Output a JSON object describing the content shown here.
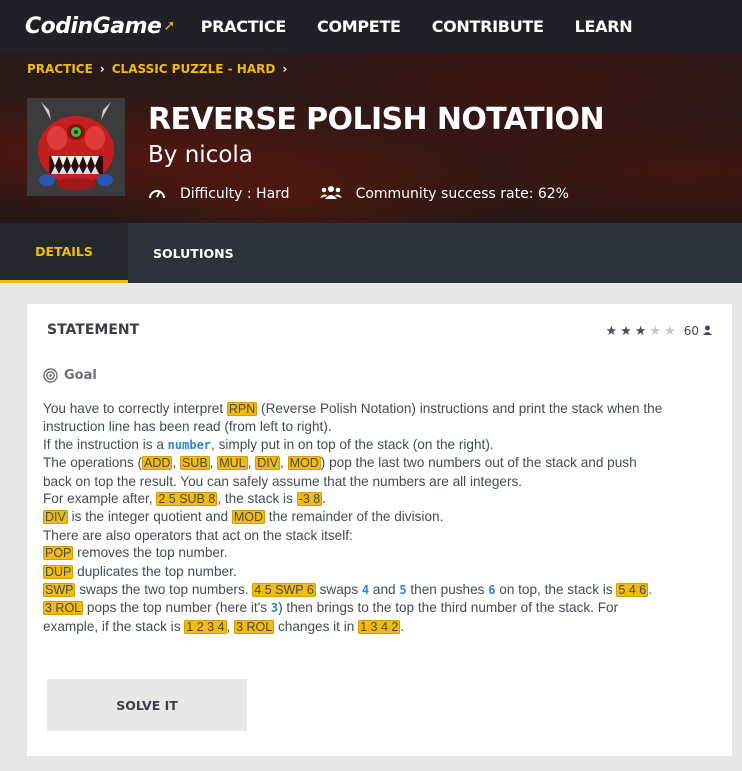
{
  "nav": {
    "logo": "CodinGame",
    "links": [
      "PRACTICE",
      "COMPETE",
      "CONTRIBUTE",
      "LEARN"
    ]
  },
  "breadcrumb": [
    "PRACTICE",
    "CLASSIC PUZZLE - HARD"
  ],
  "puzzle": {
    "title": "REVERSE POLISH NOTATION",
    "author": "By nicola",
    "difficulty": "Difficulty : Hard",
    "success_rate": "Community success rate: 62%"
  },
  "tabs": [
    "DETAILS",
    "SOLUTIONS"
  ],
  "statement": {
    "heading": "STATEMENT",
    "rating_stars": 3,
    "rating_max": 5,
    "rating_count": "60",
    "goal_label": "Goal",
    "lines": [
      [
        {
          "t": "You have to correctly interpret "
        },
        {
          "c": "RPN"
        },
        {
          "t": " (Reverse Polish Notation) instructions and print the stack when the"
        }
      ],
      [
        {
          "t": "instruction line has been read (from left to right)."
        }
      ],
      [
        {
          "t": "If the instruction is a "
        },
        {
          "v": "number"
        },
        {
          "t": ", simply put in on top of the stack (on the right)."
        }
      ],
      [
        {
          "t": "The operations ("
        },
        {
          "c": "ADD"
        },
        {
          "t": ", "
        },
        {
          "c": "SUB"
        },
        {
          "t": ", "
        },
        {
          "c": "MUL"
        },
        {
          "t": ", "
        },
        {
          "c": "DIV"
        },
        {
          "t": ", "
        },
        {
          "c": "MOD"
        },
        {
          "t": ") pop the last two numbers out of the stack and push"
        }
      ],
      [
        {
          "t": "back on top the result. You can safely assume that the numbers are all integers."
        }
      ],
      [
        {
          "t": "For example after, "
        },
        {
          "c": "2 5 SUB 8"
        },
        {
          "t": ", the stack is "
        },
        {
          "c": "-3 8"
        },
        {
          "t": "."
        }
      ],
      [
        {
          "c": "DIV"
        },
        {
          "t": " is the integer quotient and "
        },
        {
          "c": "MOD"
        },
        {
          "t": " the remainder of the division."
        }
      ],
      [
        {
          "t": "There are also operators that act on the stack itself:"
        }
      ],
      [
        {
          "c": "POP"
        },
        {
          "t": " removes the top number."
        }
      ],
      [
        {
          "c": "DUP"
        },
        {
          "t": " duplicates the top number."
        }
      ],
      [
        {
          "c": "SWP"
        },
        {
          "t": " swaps the two top numbers. "
        },
        {
          "c": "4 5 SWP 6"
        },
        {
          "t": " swaps "
        },
        {
          "v": "4"
        },
        {
          "t": " and "
        },
        {
          "v": "5"
        },
        {
          "t": " then pushes "
        },
        {
          "v": "6"
        },
        {
          "t": " on top, the stack is "
        },
        {
          "c": "5 4 6"
        },
        {
          "t": "."
        }
      ],
      [
        {
          "c": "3 ROL"
        },
        {
          "t": " pops the top number (here it's "
        },
        {
          "v": "3"
        },
        {
          "t": ") then brings to the top the third number of the stack. For"
        }
      ],
      [
        {
          "t": "example, if the stack is "
        },
        {
          "c": "1 2 3 4"
        },
        {
          "t": ", "
        },
        {
          "c": "3 ROL"
        },
        {
          "t": " changes it in "
        },
        {
          "c": "1 3 4 2"
        },
        {
          "t": "."
        }
      ]
    ],
    "solve_label": "SOLVE IT"
  },
  "icons": {
    "difficulty": "gauge-icon",
    "community": "users-icon",
    "goal": "target-icon",
    "user": "user-icon",
    "star": "star-icon"
  },
  "colors": {
    "accent": "#f2bb13",
    "variable": "#2b8ac8",
    "topbar": "#1e2127",
    "tabbar": "#2d3139"
  }
}
